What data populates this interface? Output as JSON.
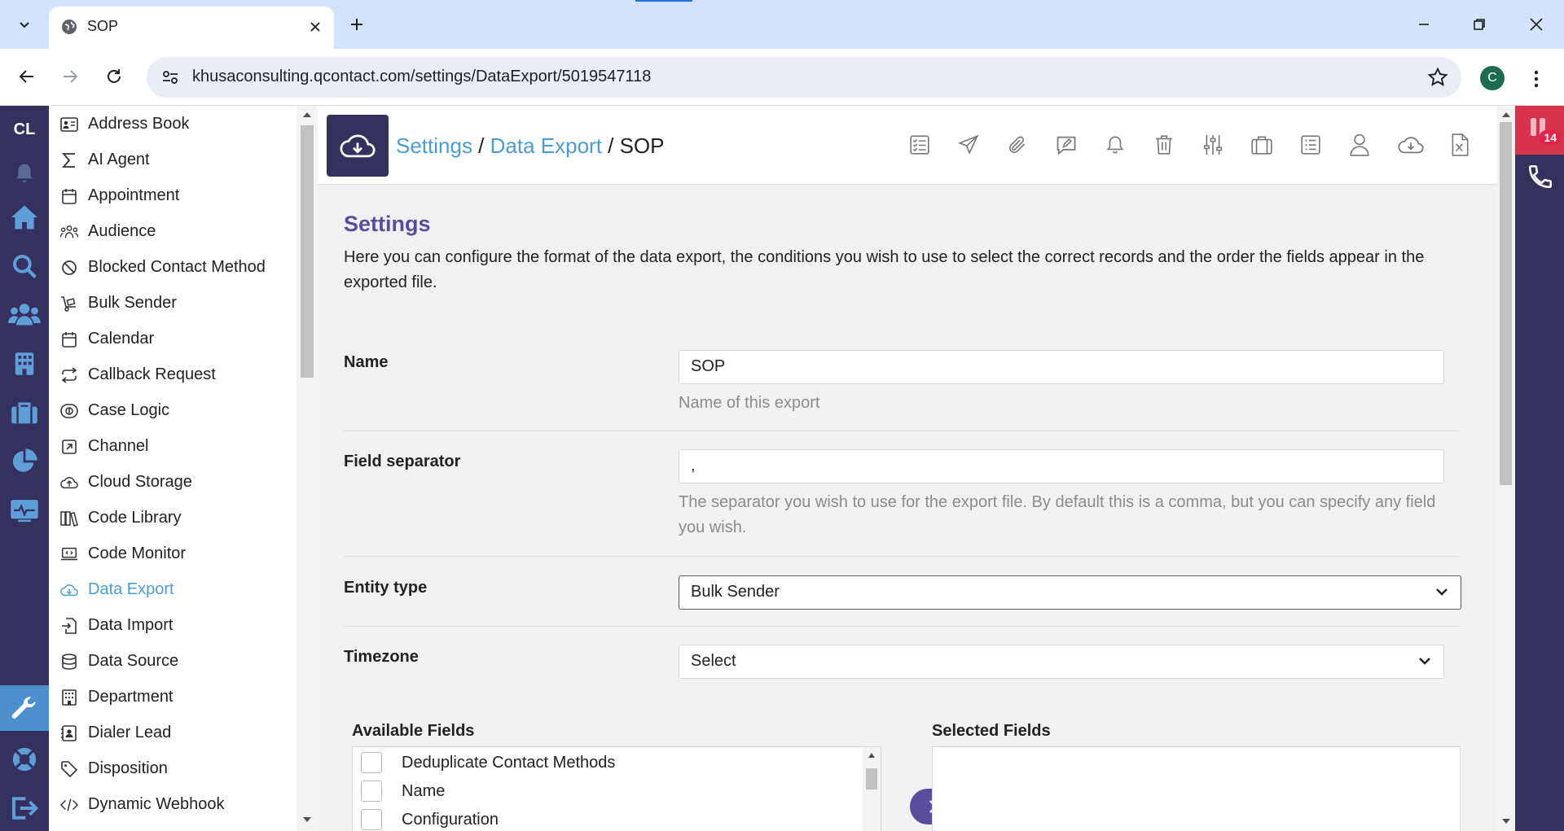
{
  "browser": {
    "tab_title": "SOP",
    "url": "khusaconsulting.qcontact.com/settings/DataExport/5019547118",
    "profile_initial": "C"
  },
  "rail": {
    "logo": "CL",
    "icons": [
      "bell-icon",
      "home-icon",
      "search-icon",
      "users-icon",
      "building-icon",
      "briefcase-icon",
      "pie-chart-icon",
      "monitor-pulse-icon",
      "wrench-icon",
      "lifebuoy-icon",
      "logout-icon"
    ]
  },
  "menu": {
    "items": [
      {
        "label": "Address Book",
        "icon": "address-card-icon"
      },
      {
        "label": "AI Agent",
        "icon": "sigma-icon"
      },
      {
        "label": "Appointment",
        "icon": "calendar-icon"
      },
      {
        "label": "Audience",
        "icon": "people-group-icon"
      },
      {
        "label": "Blocked Contact Method",
        "icon": "ban-icon"
      },
      {
        "label": "Bulk Sender",
        "icon": "dolly-icon"
      },
      {
        "label": "Calendar",
        "icon": "calendar-icon"
      },
      {
        "label": "Callback Request",
        "icon": "repeat-icon"
      },
      {
        "label": "Case Logic",
        "icon": "logic-icon"
      },
      {
        "label": "Channel",
        "icon": "external-link-icon"
      },
      {
        "label": "Cloud Storage",
        "icon": "cloud-upload-icon"
      },
      {
        "label": "Code Library",
        "icon": "books-icon"
      },
      {
        "label": "Code Monitor",
        "icon": "laptop-code-icon"
      },
      {
        "label": "Data Export",
        "icon": "cloud-download-icon"
      },
      {
        "label": "Data Import",
        "icon": "file-import-icon"
      },
      {
        "label": "Data Source",
        "icon": "database-icon"
      },
      {
        "label": "Department",
        "icon": "building-icon"
      },
      {
        "label": "Dialer Lead",
        "icon": "contact-card-icon"
      },
      {
        "label": "Disposition",
        "icon": "tag-icon"
      },
      {
        "label": "Dynamic Webhook",
        "icon": "code-icon"
      }
    ],
    "active": "Data Export"
  },
  "header": {
    "crumb_settings": "Settings",
    "sep1": " / ",
    "crumb_data_export": "Data Export",
    "sep2": " / ",
    "crumb_current": "SOP",
    "tools": [
      "checklist-icon",
      "paper-plane-icon",
      "paperclip-icon",
      "comment-edit-icon",
      "bell-icon",
      "trash-icon",
      "sliders-icon",
      "suitcase-icon",
      "list-icon",
      "user-icon",
      "cloud-download-icon",
      "file-excel-icon"
    ]
  },
  "settings": {
    "title": "Settings",
    "description": "Here you can configure the format of the data export, the conditions you wish to use to select the correct records and the order the fields appear in the exported file.",
    "name": {
      "label": "Name",
      "value": "SOP",
      "help": "Name of this export"
    },
    "separator": {
      "label": "Field separator",
      "value": ",",
      "help": "The separator you wish to use for the export file. By default this is a comma, but you can specify any field you wish."
    },
    "entity_type": {
      "label": "Entity type",
      "value": "Bulk Sender"
    },
    "timezone": {
      "label": "Timezone",
      "value": "Select"
    }
  },
  "fields": {
    "available_title": "Available Fields",
    "selected_title": "Selected Fields",
    "available": [
      "Deduplicate Contact Methods",
      "Name",
      "Configuration"
    ]
  },
  "dialer": {
    "badge": "14"
  },
  "colors": {
    "brand": "#35315f",
    "accent_link": "#4b9cd3",
    "title_purple": "#5b4b9d",
    "badge_red": "#e0244a"
  }
}
